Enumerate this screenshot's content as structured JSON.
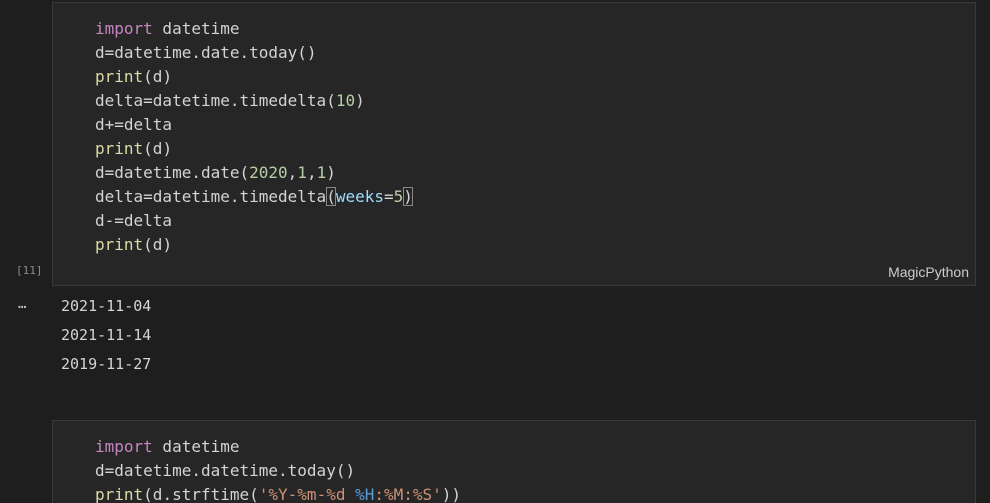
{
  "cell1": {
    "execution_count": "[11]",
    "language": "MagicPython",
    "lines": {
      "l1": {
        "kw": "import",
        "rest": " datetime"
      },
      "l2": {
        "text": "d=datetime.date.today()"
      },
      "l3": {
        "fn": "print",
        "rest": "(d)"
      },
      "l4": {
        "pre": "delta=datetime.timedelta(",
        "num": "10",
        "post": ")"
      },
      "l5": {
        "text": "d+=delta"
      },
      "l6": {
        "fn": "print",
        "rest": "(d)"
      },
      "l7": {
        "pre": "d=datetime.date(",
        "n1": "2020",
        "c1": ",",
        "n2": "1",
        "c2": ",",
        "n3": "1",
        "post": ")"
      },
      "l8": {
        "pre": "delta=datetime.timedelta",
        "open": "(",
        "param": "weeks",
        "eq": "=",
        "num": "5",
        "close": ")"
      },
      "l9": {
        "text": "d-=delta"
      },
      "l10": {
        "fn": "print",
        "rest": "(d)"
      }
    }
  },
  "output1": {
    "more_icon": "…",
    "lines": [
      "2021-11-04",
      "2021-11-14",
      "2019-11-27"
    ]
  },
  "cell2": {
    "lines": {
      "l1": {
        "kw": "import",
        "rest": " datetime"
      },
      "l2": {
        "text": "d=datetime.datetime.today()"
      },
      "l3": {
        "fn": "print",
        "pre": "(d.strftime(",
        "s1": "'%Y-%m-%d ",
        "e1": "%H",
        "s2": ":%M:%S'",
        "post": "))"
      }
    }
  }
}
